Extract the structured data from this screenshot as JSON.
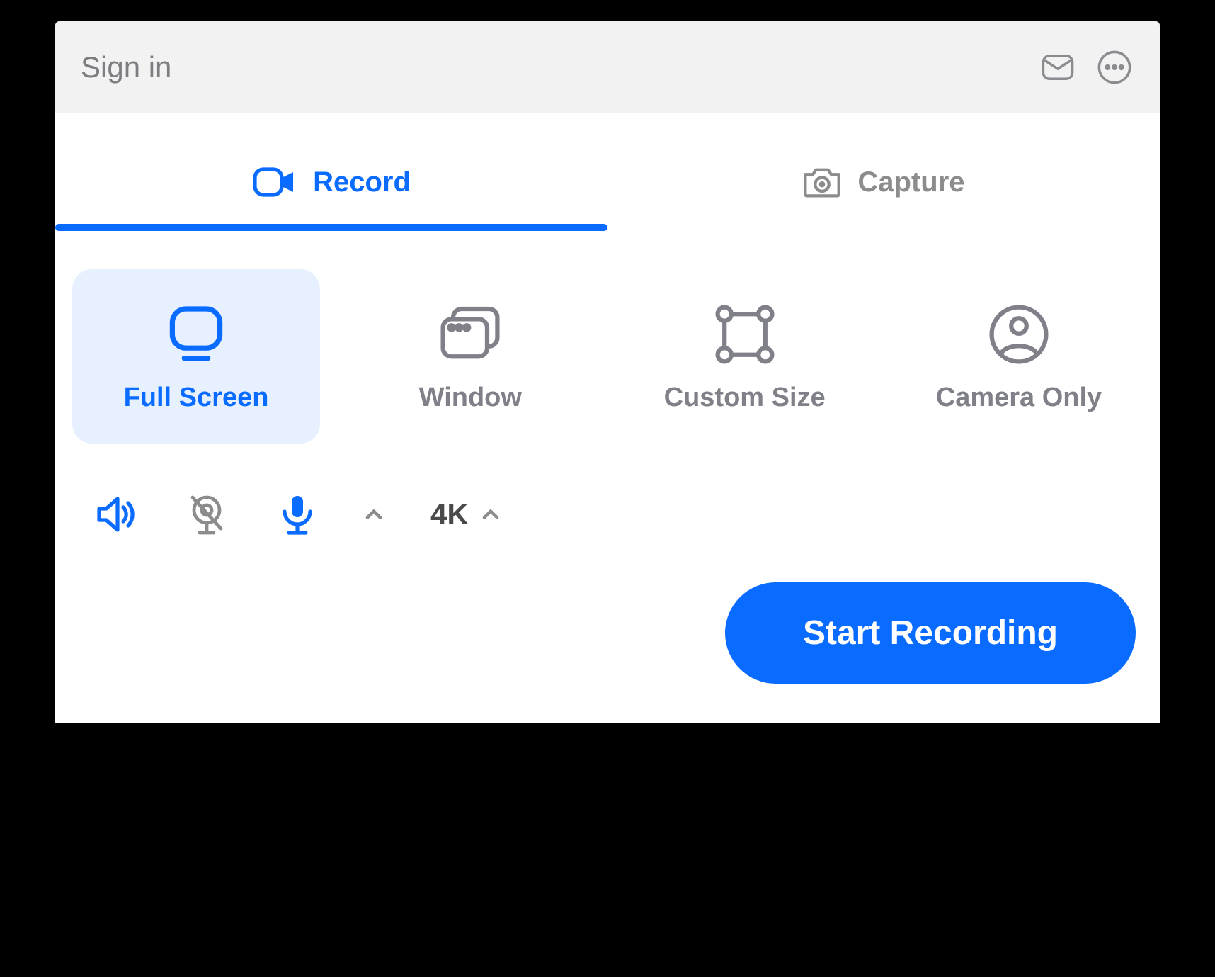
{
  "titlebar": {
    "sign_in_label": "Sign in",
    "icons": {
      "mail": "mail-icon",
      "more": "more-icon"
    }
  },
  "tabs": {
    "record": {
      "label": "Record",
      "active": true
    },
    "capture": {
      "label": "Capture",
      "active": false
    }
  },
  "modes": {
    "full_screen": {
      "label": "Full Screen",
      "active": true
    },
    "window": {
      "label": "Window",
      "active": false
    },
    "custom_size": {
      "label": "Custom Size",
      "active": false
    },
    "camera_only": {
      "label": "Camera Only",
      "active": false
    }
  },
  "options": {
    "system_audio_on": true,
    "webcam_on": false,
    "microphone_on": true,
    "resolution_label": "4K"
  },
  "actions": {
    "start_label": "Start Recording"
  },
  "colors": {
    "accent": "#096bff",
    "muted": "#8c8c8c",
    "selected_bg": "#e6f0ff"
  }
}
